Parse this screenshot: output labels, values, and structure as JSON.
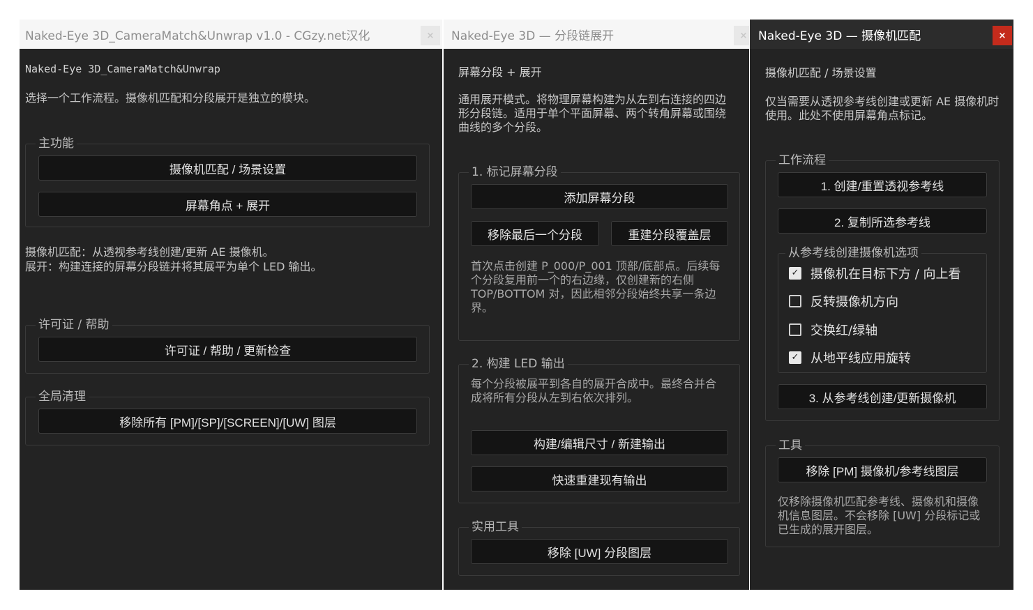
{
  "colors": {
    "panel_bg": "#232323",
    "button_bg": "#141414",
    "close_red": "#c42b1c"
  },
  "icons": {
    "close": "close-icon",
    "check": "checkmark-icon"
  },
  "win1": {
    "title": "Naked-Eye 3D_CameraMatch&Unwrap v1.0 - CGzy.net汉化",
    "close": "×",
    "header": "Naked-Eye 3D_CameraMatch&Unwrap",
    "intro": "选择一个工作流程。摄像机匹配和分段展开是独立的模块。",
    "main_group": {
      "legend": "主功能",
      "camera_btn": "摄像机匹配 / 场景设置",
      "corners_btn": "屏幕角点 + 展开"
    },
    "desc_line1": "摄像机匹配：从透视参考线创建/更新 AE 摄像机。",
    "desc_line2": "展开：构建连接的屏幕分段链并将其展平为单个 LED 输出。",
    "license_group": {
      "legend": "许可证 / 帮助",
      "btn": "许可证 / 帮助 / 更新检查"
    },
    "cleanup_group": {
      "legend": "全局清理",
      "btn": "移除所有 [PM]/[SP]/[SCREEN]/[UW] 图层"
    }
  },
  "win2": {
    "title": "Naked-Eye 3D — 分段链展开",
    "close": "×",
    "header": "屏幕分段 + 展开",
    "intro": "通用展开模式。将物理屏幕构建为从左到右连接的四边形分段链。适用于单个平面屏幕、两个转角屏幕或围绕曲线的多个分段。",
    "mark_group": {
      "legend": "1. 标记屏幕分段",
      "add_btn": "添加屏幕分段",
      "remove_last_btn": "移除最后一个分段",
      "rebuild_btn": "重建分段覆盖层",
      "note": "首次点击创建 P_000/P_001 顶部/底部点。后续每个分段复用前一个的右边缘，仅创建新的右侧 TOP/BOTTOM 对，因此相邻分段始终共享一条边界。"
    },
    "build_group": {
      "legend": "2. 构建 LED 输出",
      "note": "每个分段被展平到各自的展开合成中。最终合并合成将所有分段从左到右依次排列。",
      "build_btn": "构建/编辑尺寸 / 新建输出",
      "quick_btn": "快速重建现有输出"
    },
    "util_group": {
      "legend": "实用工具",
      "remove_btn": "移除 [UW] 分段图层"
    }
  },
  "win3": {
    "title": "Naked-Eye 3D — 摄像机匹配",
    "close": "×",
    "header": "摄像机匹配 / 场景设置",
    "intro": "仅当需要从透视参考线创建或更新 AE 摄像机时使用。此处不使用屏幕角点标记。",
    "workflow_group": {
      "legend": "工作流程",
      "create_btn": "1. 创建/重置透视参考线",
      "copy_btn": "2. 复制所选参考线",
      "options": {
        "legend": "从参考线创建摄像机选项",
        "items": [
          {
            "label": "摄像机在目标下方 / 向上看",
            "checked": "✓"
          },
          {
            "label": "反转摄像机方向",
            "checked": ""
          },
          {
            "label": "交换红/绿轴",
            "checked": ""
          },
          {
            "label": "从地平线应用旋转",
            "checked": "✓"
          }
        ]
      },
      "apply_btn": "3. 从参考线创建/更新摄像机"
    },
    "tools_group": {
      "legend": "工具",
      "remove_btn": "移除 [PM] 摄像机/参考线图层",
      "note": "仅移除摄像机匹配参考线、摄像机和摄像机信息图层。不会移除 [UW] 分段标记或已生成的展开图层。"
    }
  }
}
